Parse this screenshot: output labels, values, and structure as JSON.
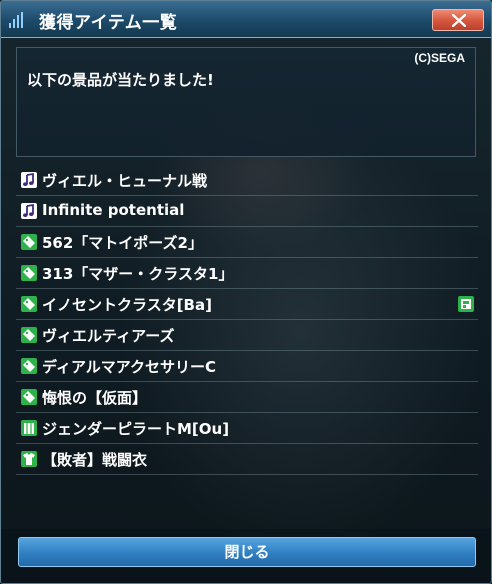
{
  "window": {
    "title": "獲得アイテム一覧",
    "title_icon": "signal-bars-icon",
    "close_icon": "close-x-icon"
  },
  "message_box": {
    "copyright": "(C)SEGA",
    "message": "以下の景品が当たりました!"
  },
  "items": [
    {
      "label": "ヴィエル・ヒューナル戦",
      "icon": "music-note-icon"
    },
    {
      "label": "Infinite potential",
      "icon": "music-note-icon"
    },
    {
      "label": "562「マトイポーズ2」",
      "icon": "ticket-icon"
    },
    {
      "label": "313「マザー・クラスタ1」",
      "icon": "ticket-icon"
    },
    {
      "label": "イノセントクラスタ[Ba]",
      "icon": "ticket-icon",
      "badge": "new-item-icon"
    },
    {
      "label": "ヴィエルティアーズ",
      "icon": "ticket-icon"
    },
    {
      "label": "ディアルマアクセサリーC",
      "icon": "ticket-icon"
    },
    {
      "label": "悔恨の【仮面】",
      "icon": "ticket-icon"
    },
    {
      "label": "ジェンダーピラートM[Ou]",
      "icon": "outfit-icon"
    },
    {
      "label": "【敗者】戦闘衣",
      "icon": "costume-icon"
    }
  ],
  "footer": {
    "close_label": "閉じる"
  },
  "colors": {
    "titlebar": "#1d4a6a",
    "close_button": "#d4563e",
    "primary_button": "#2f7fc2",
    "icon_green": "#2fb24b"
  }
}
